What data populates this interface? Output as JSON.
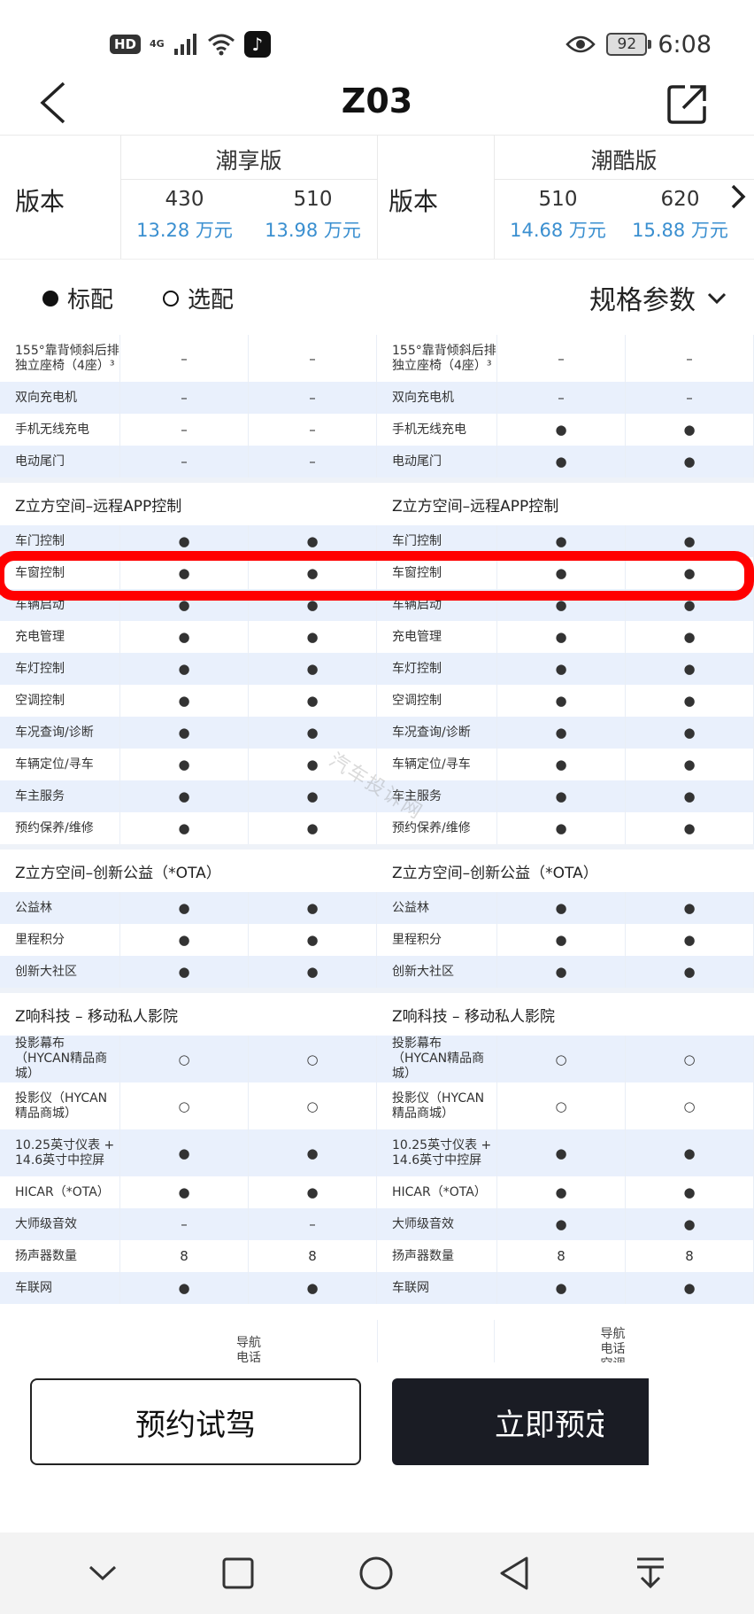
{
  "status_bar": {
    "hd": "HD",
    "network": "4G",
    "battery": "92",
    "time": "6:08"
  },
  "header": {
    "title": "Z03"
  },
  "versions": {
    "label": "版本",
    "groups": [
      {
        "name": "潮享版",
        "editions": [
          {
            "capacity": "430",
            "price": "13.28 万元"
          },
          {
            "capacity": "510",
            "price": "13.98 万元"
          }
        ]
      },
      {
        "name": "潮酷版",
        "editions": [
          {
            "capacity": "510",
            "price": "14.68 万元"
          },
          {
            "capacity": "620",
            "price": "15.88 万元"
          }
        ]
      }
    ]
  },
  "legend": {
    "standard": "标配",
    "optional": "选配",
    "spec_dropdown": "规格参数"
  },
  "table": {
    "rows": [
      {
        "type": "item",
        "label": "155°靠背倾斜后排独立座椅（4座）³",
        "v": [
          "–",
          "–",
          "–",
          "–"
        ],
        "tall": true
      },
      {
        "type": "item",
        "label": "双向充电机",
        "v": [
          "–",
          "–",
          "–",
          "–"
        ]
      },
      {
        "type": "item",
        "label": "手机无线充电",
        "v": [
          "–",
          "–",
          "●",
          "●"
        ]
      },
      {
        "type": "item",
        "label": "电动尾门",
        "v": [
          "–",
          "–",
          "●",
          "●"
        ]
      },
      {
        "type": "section",
        "label": "Z立方空间–远程APP控制"
      },
      {
        "type": "item",
        "label": "车门控制",
        "v": [
          "●",
          "●",
          "●",
          "●"
        ]
      },
      {
        "type": "item",
        "label": "车窗控制",
        "v": [
          "●",
          "●",
          "●",
          "●"
        ]
      },
      {
        "type": "item",
        "label": "车辆启动",
        "v": [
          "●",
          "●",
          "●",
          "●"
        ]
      },
      {
        "type": "item",
        "label": "充电管理",
        "v": [
          "●",
          "●",
          "●",
          "●"
        ]
      },
      {
        "type": "item",
        "label": "车灯控制",
        "v": [
          "●",
          "●",
          "●",
          "●"
        ]
      },
      {
        "type": "item",
        "label": "空调控制",
        "v": [
          "●",
          "●",
          "●",
          "●"
        ]
      },
      {
        "type": "item",
        "label": "车况查询/诊断",
        "v": [
          "●",
          "●",
          "●",
          "●"
        ]
      },
      {
        "type": "item",
        "label": "车辆定位/寻车",
        "v": [
          "●",
          "●",
          "●",
          "●"
        ]
      },
      {
        "type": "item",
        "label": "车主服务",
        "v": [
          "●",
          "●",
          "●",
          "●"
        ]
      },
      {
        "type": "item",
        "label": "预约保养/维修",
        "v": [
          "●",
          "●",
          "●",
          "●"
        ]
      },
      {
        "type": "section",
        "label": "Z立方空间–创新公益（*OTA）"
      },
      {
        "type": "item",
        "label": "公益林",
        "v": [
          "●",
          "●",
          "●",
          "●"
        ]
      },
      {
        "type": "item",
        "label": "里程积分",
        "v": [
          "●",
          "●",
          "●",
          "●"
        ]
      },
      {
        "type": "item",
        "label": "创新大社区",
        "v": [
          "●",
          "●",
          "●",
          "●"
        ]
      },
      {
        "type": "section",
        "label": "Z响科技 – 移动私人影院"
      },
      {
        "type": "item",
        "label": "投影幕布（HYCAN精品商城）",
        "v": [
          "○",
          "○",
          "○",
          "○"
        ],
        "tall": true
      },
      {
        "type": "item",
        "label": "投影仪（HYCAN精品商城）",
        "v": [
          "○",
          "○",
          "○",
          "○"
        ],
        "tall": true
      },
      {
        "type": "item",
        "label": "10.25英寸仪表 + 14.6英寸中控屏",
        "v": [
          "●",
          "●",
          "●",
          "●"
        ],
        "tall": true
      },
      {
        "type": "item",
        "label": "HICAR（*OTA）",
        "v": [
          "●",
          "●",
          "●",
          "●"
        ]
      },
      {
        "type": "item",
        "label": "大师级音效",
        "v": [
          "–",
          "–",
          "●",
          "●"
        ]
      },
      {
        "type": "item",
        "label": "扬声器数量",
        "v": [
          "8",
          "8",
          "8",
          "8"
        ]
      },
      {
        "type": "item",
        "label": "车联网",
        "v": [
          "●",
          "●",
          "●",
          "●"
        ]
      }
    ],
    "partial_cells": [
      "导航\n电话",
      "导航\n电话\n空调"
    ]
  },
  "watermark": "汽车投诉网",
  "buttons": {
    "test_drive": "预约试驾",
    "order": "立即预定"
  },
  "icons": {
    "back": "chevron-left-icon",
    "share": "share-icon",
    "next": "chevron-right-icon",
    "dropdown": "chevron-down-icon"
  }
}
